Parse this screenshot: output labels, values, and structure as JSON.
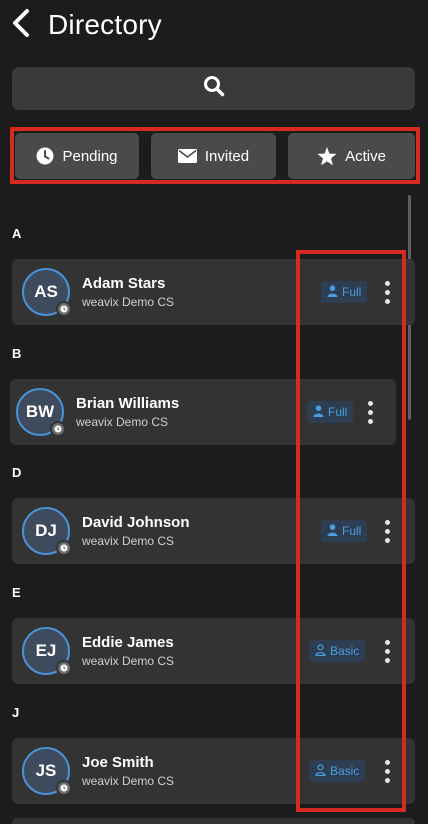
{
  "header": {
    "title": "Directory"
  },
  "search": {
    "icon": "search-icon"
  },
  "tabs": [
    {
      "label": "Pending",
      "icon": "clock-icon"
    },
    {
      "label": "Invited",
      "icon": "envelope-icon"
    },
    {
      "label": "Active",
      "icon": "star-icon"
    }
  ],
  "sections": [
    {
      "letter": "A",
      "contact": {
        "initials": "AS",
        "name": "Adam Stars",
        "org": "weavix Demo CS",
        "badge": "Full"
      }
    },
    {
      "letter": "B",
      "contact": {
        "initials": "BW",
        "name": "Brian Williams",
        "org": "weavix Demo CS",
        "badge": "Full"
      }
    },
    {
      "letter": "D",
      "contact": {
        "initials": "DJ",
        "name": "David Johnson",
        "org": "weavix Demo CS",
        "badge": "Full"
      }
    },
    {
      "letter": "E",
      "contact": {
        "initials": "EJ",
        "name": "Eddie James",
        "org": "weavix Demo CS",
        "badge": "Basic"
      }
    },
    {
      "letter": "J",
      "contact": {
        "initials": "JS",
        "name": "Joe Smith",
        "org": "weavix Demo CS",
        "badge": "Basic"
      }
    }
  ],
  "colors": {
    "background": "#1c1c1c",
    "card": "#333333",
    "accent_blue": "#4a9ee0",
    "highlight_red": "#d42a20"
  }
}
